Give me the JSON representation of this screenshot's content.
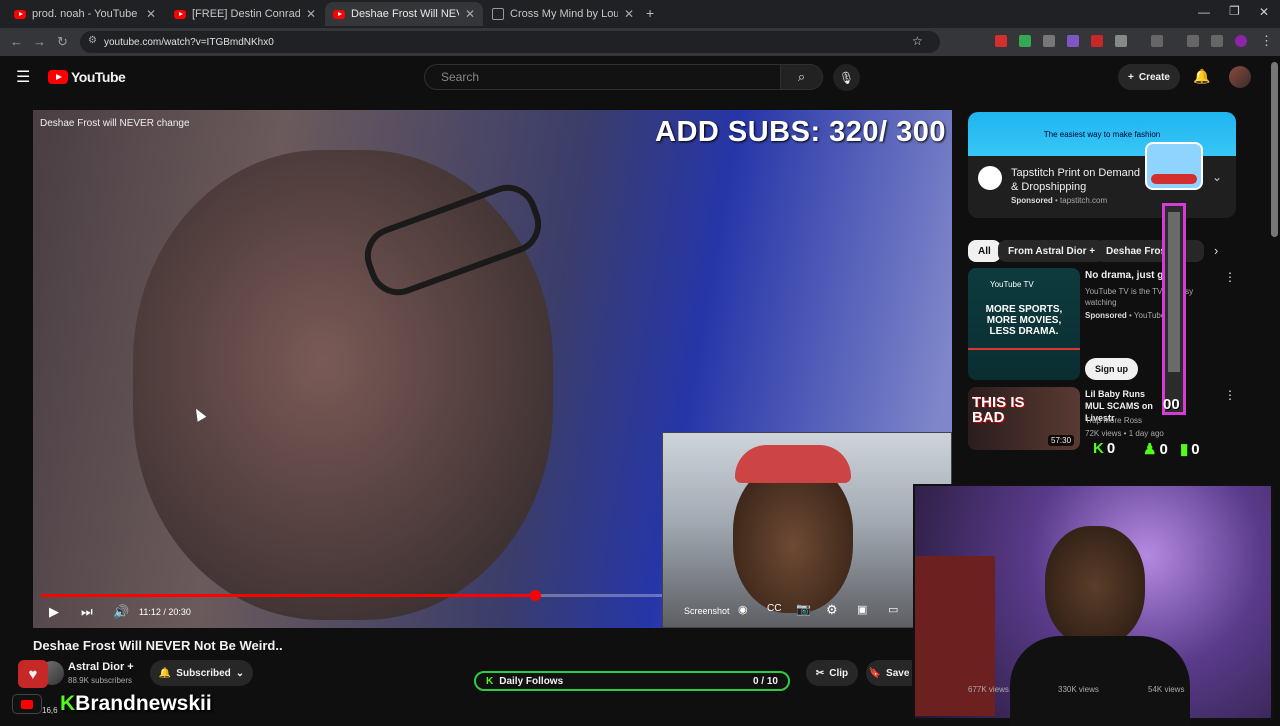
{
  "browser": {
    "tabs": [
      {
        "title": "prod. noah - YouTube",
        "favicon": "youtube-icon"
      },
      {
        "title": "[FREE] Destin Conrad x Kehlani",
        "favicon": "youtube-icon"
      },
      {
        "title": "Deshae Frost Will NEVER Not Be",
        "favicon": "youtube-icon",
        "active": true
      },
      {
        "title": "Cross My Mind by Lou Xtwo",
        "favicon": "page-icon"
      }
    ],
    "url": "youtube.com/watch?v=ITGBmdNKhx0"
  },
  "youtube": {
    "logo_text": "YouTube",
    "search_placeholder": "Search",
    "create_label": "Create"
  },
  "video": {
    "overlay_title": "Deshae Frost will NEVER change",
    "time": "11:12 / 20:30",
    "progress_fraction": 0.547,
    "screenshot_label": "Screenshot",
    "title": "Deshae Frost Will NEVER Not Be Weird..",
    "channel": "Astral Dior +",
    "subscribers": "88.9K subscribers",
    "subscribed_label": "Subscribed",
    "clip_label": "Clip",
    "save_label": "Save"
  },
  "sidebar": {
    "ad": {
      "banner": "The easiest way to make fashion",
      "title": "Tapstitch Print on Demand & Dropshipping",
      "sponsored": "Sponsored",
      "domain": "tapstitch.com"
    },
    "chips": [
      "All",
      "From Astral Dior +",
      "Deshae Frost"
    ],
    "items": [
      {
        "thumb_text": "MORE SPORTS, MORE MOVIES, LESS DRAMA.",
        "thumb_brand": "YouTube TV",
        "title": "No drama, just goo",
        "desc": "YouTube TV is the TV for easy watching",
        "sponsored": "Sponsored",
        "channel": "YouTube",
        "cta": "Sign up"
      },
      {
        "thumb_text": "THIS IS BAD",
        "duration": "57:30",
        "title": "Lil Baby Runs MUL SCAMS on Livestr",
        "channel": "Trap More Ross",
        "meta": "72K views • 1 day ago"
      }
    ],
    "views_row": [
      "677K views",
      "330K views",
      "54K views"
    ]
  },
  "overlay": {
    "subs_goal": "ADD SUBS: 320/ 300",
    "daily_follows_label": "Daily Follows",
    "daily_follows_count": "0 / 10",
    "brand_name": "Brandnewskii",
    "bottom_counter": "16,6",
    "meter_value": "00",
    "stats": [
      "0",
      "0",
      "0"
    ],
    "accent_kick": "#53fc18",
    "accent_meter": "#d63bd6"
  }
}
